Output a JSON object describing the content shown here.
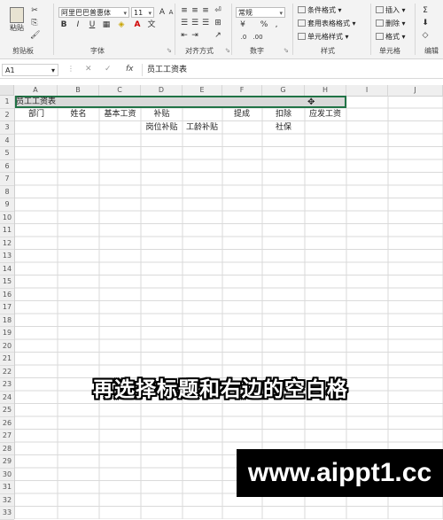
{
  "ribbon": {
    "clipboard": {
      "paste_label": "粘贴",
      "group_label": "剪贴板"
    },
    "font": {
      "font_name": "阿里巴巴普惠体",
      "font_size": "11",
      "bold": "B",
      "italic": "I",
      "underline": "U",
      "group_label": "字体"
    },
    "alignment": {
      "group_label": "对齐方式"
    },
    "number": {
      "format_value": "常规",
      "percent": "%",
      "group_label": "数字"
    },
    "styles": {
      "conditional": "条件格式",
      "table": "套用表格格式",
      "cell_styles": "单元格样式",
      "group_label": "样式"
    },
    "cells": {
      "insert": "插入",
      "delete": "删除",
      "format": "格式",
      "group_label": "单元格"
    },
    "editing": {
      "group_label": "编辑"
    }
  },
  "formula_bar": {
    "name_box": "A1",
    "fx": "fx",
    "content": "员工工资表"
  },
  "grid": {
    "columns": [
      "A",
      "B",
      "C",
      "D",
      "E",
      "F",
      "G",
      "H",
      "I",
      "J"
    ],
    "rows": [
      "1",
      "2",
      "3",
      "4",
      "5",
      "6",
      "7",
      "8",
      "9",
      "10",
      "11",
      "12",
      "13",
      "14",
      "15",
      "16",
      "17",
      "18",
      "19",
      "20",
      "21",
      "22",
      "23",
      "24",
      "25",
      "26",
      "27",
      "28",
      "29",
      "30",
      "31",
      "32",
      "33"
    ],
    "cells": {
      "a1": "员工工资表",
      "a2": "部门",
      "b2": "姓名",
      "c2": "基本工资",
      "d2": "补贴",
      "f2": "提成",
      "g2": "扣除",
      "h2": "应发工资",
      "d3": "岗位补贴",
      "e3": "工龄补贴",
      "g3": "社保"
    }
  },
  "caption": "再选择标题和右边的空白格",
  "watermark": "www.aippt1.cc"
}
